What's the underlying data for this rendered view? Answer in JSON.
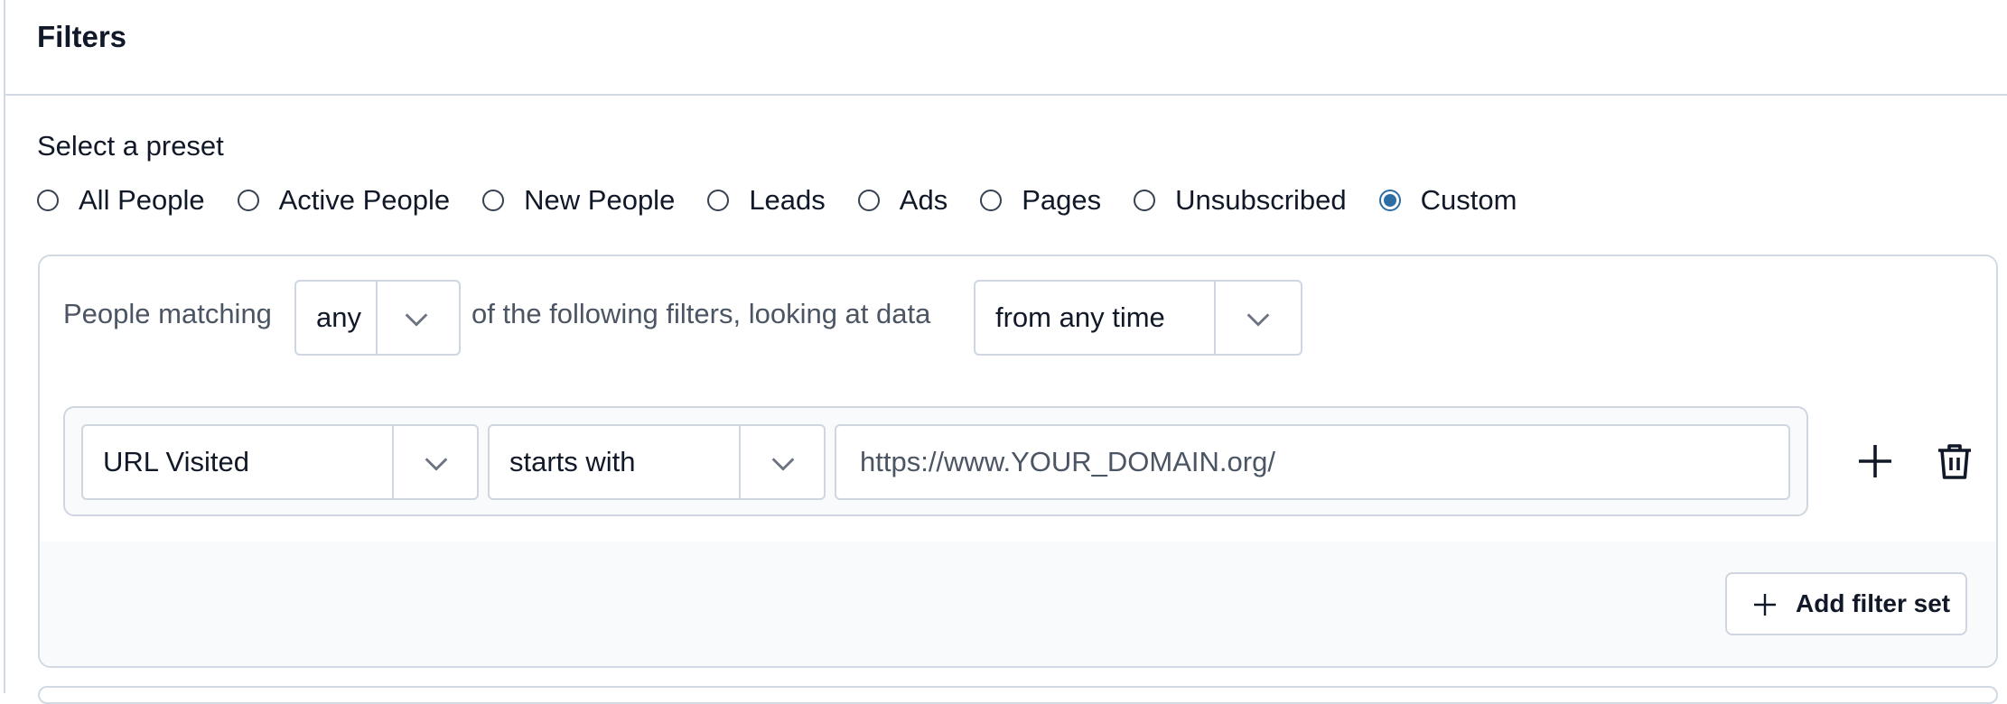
{
  "header": {
    "title": "Filters"
  },
  "preset": {
    "label": "Select a preset",
    "options": [
      {
        "label": "All People",
        "checked": false
      },
      {
        "label": "Active People",
        "checked": false
      },
      {
        "label": "New People",
        "checked": false
      },
      {
        "label": "Leads",
        "checked": false
      },
      {
        "label": "Ads",
        "checked": false
      },
      {
        "label": "Pages",
        "checked": false
      },
      {
        "label": "Unsubscribed",
        "checked": false
      },
      {
        "label": "Custom",
        "checked": true
      }
    ]
  },
  "matching": {
    "prefix": "People matching",
    "match_value": "any",
    "middle": "of the following filters, looking at data",
    "time_value": "from any time"
  },
  "filter": {
    "field_value": "URL Visited",
    "operator_value": "starts with",
    "url_value": "https://www.YOUR_DOMAIN.org/",
    "add_icon": "plus-icon",
    "delete_icon": "trash-icon"
  },
  "footer": {
    "add_filter_set_label": "Add filter set"
  },
  "colors": {
    "accent": "#2e6da4",
    "border": "#d1d9e3",
    "muted_bg": "#f8fafc"
  }
}
